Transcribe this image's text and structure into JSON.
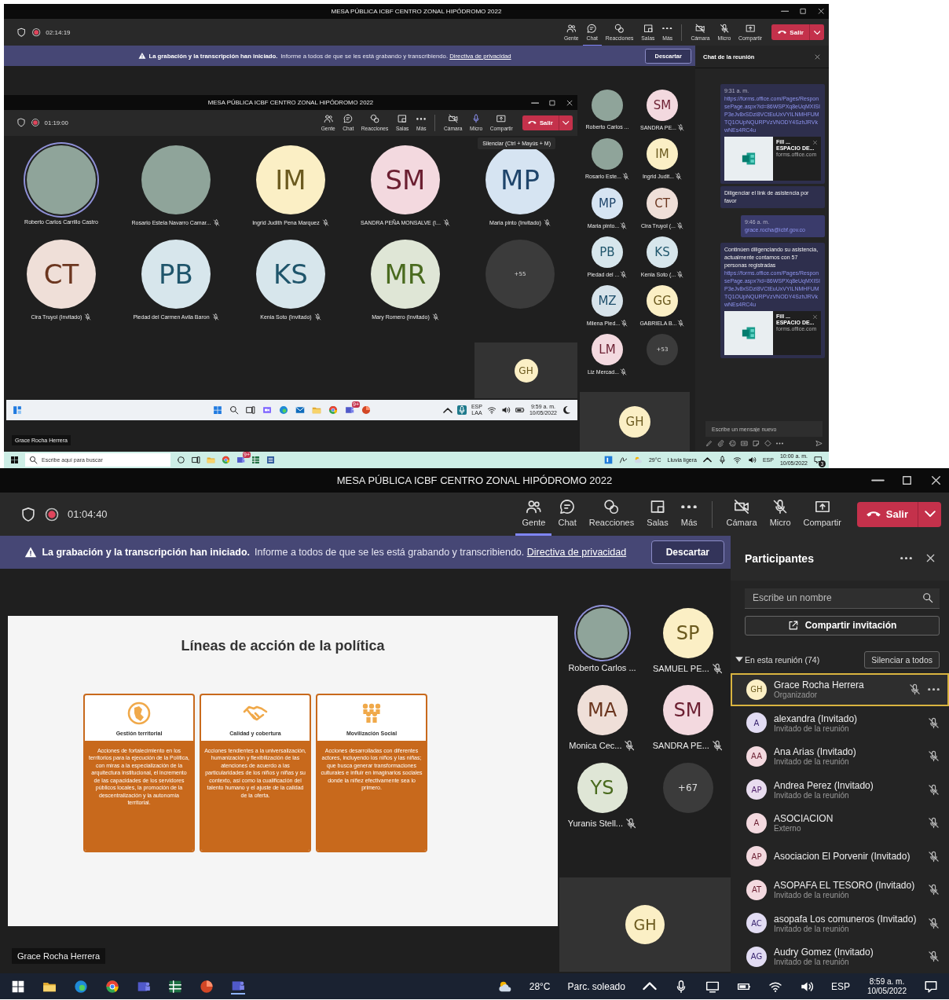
{
  "top": {
    "window": {
      "title": "MESA PÚBLICA ICBF CENTRO ZONAL HIPÓDROMO 2022"
    },
    "timer": "02:14:19",
    "tools": [
      {
        "kind": "people",
        "label": "Gente",
        "selected": false
      },
      {
        "kind": "chat",
        "label": "Chat",
        "selected": true
      },
      {
        "kind": "reactions",
        "label": "Reacciones",
        "selected": false
      },
      {
        "kind": "rooms",
        "label": "Salas",
        "selected": false
      },
      {
        "kind": "more",
        "label": "Más",
        "selected": false
      }
    ],
    "controls": [
      {
        "kind": "camera",
        "label": "Cámara",
        "on": false
      },
      {
        "kind": "mic",
        "label": "Micro",
        "on": false
      },
      {
        "kind": "share",
        "label": "Compartir"
      }
    ],
    "leave": "Salir",
    "banner": {
      "title": "La grabación y la transcripción han iniciado.",
      "text": "Informe a todos de que se les está grabando y transcribiendo.",
      "link": "Directiva de privacidad",
      "button": "Descartar"
    },
    "shared_screen": {
      "window": {
        "title": "MESA PÚBLICA ICBF CENTRO ZONAL HIPÓDROMO 2022"
      },
      "timer": "01:19:00",
      "tools": [
        {
          "kind": "people",
          "label": "Gente",
          "selected": false
        },
        {
          "kind": "chat",
          "label": "Chat",
          "selected": false
        },
        {
          "kind": "reactions",
          "label": "Reacciones",
          "selected": false
        },
        {
          "kind": "rooms",
          "label": "Salas",
          "selected": false
        },
        {
          "kind": "more",
          "label": "Más",
          "selected": false
        }
      ],
      "controls": [
        {
          "kind": "camera",
          "label": "Cámara",
          "on": false
        },
        {
          "kind": "mic",
          "label": "Micro",
          "on": true
        },
        {
          "kind": "share",
          "label": "Compartir"
        }
      ],
      "leave": "Salir",
      "tooltip": "Silenciar (Ctrl + Mayús + M)",
      "tiles": [
        {
          "kind": "photo",
          "name": "Roberto Carlos Carrillo Castro",
          "speaking": true,
          "muted": false
        },
        {
          "kind": "photo",
          "name": "Rosario Estela Navarro Camar...",
          "speaking": false,
          "muted": true
        },
        {
          "kind": "initials",
          "initials": "IM",
          "color": "#fbefc5",
          "name": "Ingrid Judith Pena Marquez",
          "speaking": false,
          "muted": true
        },
        {
          "kind": "initials",
          "initials": "SM",
          "color": "#f3d9df",
          "name": "SANDRA PEÑA MONSALVE (I...",
          "speaking": false,
          "muted": true
        },
        {
          "kind": "initials",
          "initials": "MP",
          "color": "#d6e4f2",
          "name": "Maria pinto (Invitado)",
          "speaking": false,
          "muted": true
        },
        {
          "kind": "initials",
          "initials": "CT",
          "color": "#efdfd8",
          "name": "Cira Truyol (Invitado)",
          "speaking": false,
          "muted": true
        },
        {
          "kind": "initials",
          "initials": "PB",
          "color": "#d7e6ec",
          "name": "Piedad del Carmen Avila Baron",
          "speaking": false,
          "muted": true
        },
        {
          "kind": "initials",
          "initials": "KS",
          "color": "#d7e6ec",
          "name": "Kenia Soto (Invitado)",
          "speaking": false,
          "muted": true
        },
        {
          "kind": "initials",
          "initials": "MR",
          "color": "#dfe6d6",
          "name": "Mary Romero (Invitado)",
          "speaking": false,
          "muted": true
        },
        {
          "kind": "overflow",
          "label": "+55"
        }
      ],
      "self": {
        "initials": "GH",
        "color": "#fbefc5"
      },
      "taskbar": {
        "badge": "9+",
        "language": "ESP",
        "layout": "LAA",
        "time": "9:59 a. m.",
        "date": "10/05/2022"
      }
    },
    "gallery": [
      {
        "kind": "photo",
        "name": "Roberto Carlos ...",
        "speaking": false,
        "muted": false
      },
      {
        "kind": "initials",
        "initials": "SM",
        "color": "#f3d9df",
        "name": "SANDRA PE...",
        "speaking": false,
        "muted": true
      },
      {
        "kind": "photo",
        "name": "Rosario Este...",
        "speaking": false,
        "muted": true
      },
      {
        "kind": "initials",
        "initials": "IM",
        "color": "#fbefc5",
        "name": "Ingrid Judit...",
        "speaking": false,
        "muted": true
      },
      {
        "kind": "initials",
        "initials": "MP",
        "color": "#d6e4f2",
        "name": "Maria pinto...",
        "speaking": false,
        "muted": true
      },
      {
        "kind": "initials",
        "initials": "CT",
        "color": "#efdfd8",
        "name": "Cira Truyol (...",
        "speaking": false,
        "muted": true
      },
      {
        "kind": "initials",
        "initials": "PB",
        "color": "#d7e6ec",
        "name": "Piedad del ...",
        "speaking": false,
        "muted": true
      },
      {
        "kind": "initials",
        "initials": "KS",
        "color": "#d7e6ec",
        "name": "Kenia Soto (...",
        "speaking": false,
        "muted": true
      },
      {
        "kind": "initials",
        "initials": "MZ",
        "color": "#d7e3ea",
        "name": "Milena Pied...",
        "speaking": false,
        "muted": true
      },
      {
        "kind": "initials",
        "initials": "GG",
        "color": "#fbefc5",
        "name": "GABRIELA B...",
        "speaking": false,
        "muted": true
      },
      {
        "kind": "initials",
        "initials": "LM",
        "color": "#f3d9df",
        "name": "Liz Mercad...",
        "speaking": false,
        "muted": true
      },
      {
        "kind": "overflow",
        "label": "+53"
      }
    ],
    "self": {
      "initials": "GH",
      "color": "#fbefc5"
    },
    "name_tag": "Grace Rocha Herrera",
    "chat": {
      "title": "Chat de la reunión",
      "messages": [
        {
          "self": false,
          "time": "9:31 a. m.",
          "link": "https://forms.office.com/Pages/ResponsePage.aspx?id=86WSPXq8eUqMXISIP3eJv8xSDzi8VCtEuUxVYILNMHFUMTQ1OUpNQURPVzVNODY4SzhJRVkwNEs4RC4u",
          "card": {
            "title": "Fill ...",
            "subtitle": "ESPACIO DE...",
            "domain": "forms.office.com"
          }
        },
        {
          "self": false,
          "text": "Diligenciar el link de asistencia por favor"
        },
        {
          "self": true,
          "time": "9:46 a. m.",
          "link": "grace.rocha@icbf.gov.co"
        },
        {
          "self": false,
          "text": "Continúen diligenciando su asistencia, actualmente contamos con 57 personas registradas",
          "link": "https://forms.office.com/Pages/ResponsePage.aspx?id=86WSPXq8eUqMXISIP3eJv8xSDzi8VCtEuUxVYILNMHFUMTQ1OUpNQURPVzVNODY4SzhJRVkwNEs4RC4u",
          "card": {
            "title": "Fill ...",
            "subtitle": "ESPACIO DE...",
            "domain": "forms.office.com"
          }
        }
      ],
      "compose": {
        "placeholder": "Escribe un mensaje nuevo"
      }
    },
    "taskbar": {
      "search": {
        "placeholder": "Escribe aquí para buscar"
      },
      "badge": "9+",
      "temperature": "29°C",
      "weather": "Lluvia ligera",
      "language": "ESP",
      "time": "10:00 a. m.",
      "date": "10/05/2022",
      "notifications": "3"
    }
  },
  "bottom": {
    "window": {
      "title": "MESA PÚBLICA ICBF CENTRO ZONAL HIPÓDROMO 2022"
    },
    "timer": "01:04:40",
    "tools": [
      {
        "kind": "people",
        "label": "Gente",
        "selected": true
      },
      {
        "kind": "chat",
        "label": "Chat",
        "selected": false
      },
      {
        "kind": "reactions",
        "label": "Reacciones",
        "selected": false
      },
      {
        "kind": "rooms",
        "label": "Salas",
        "selected": false
      },
      {
        "kind": "more",
        "label": "Más",
        "selected": false
      }
    ],
    "controls": [
      {
        "kind": "camera",
        "label": "Cámara",
        "on": false
      },
      {
        "kind": "mic",
        "label": "Micro",
        "on": false
      },
      {
        "kind": "share",
        "label": "Compartir"
      }
    ],
    "leave": "Salir",
    "banner": {
      "title": "La grabación y la transcripción han iniciado.",
      "text": "Informe a todos de que se les está grabando y transcribiendo.",
      "link": "Directiva de privacidad",
      "button": "Descartar"
    },
    "slide": {
      "title": "Líneas de acción de la política",
      "cards": [
        {
          "kind": "globe",
          "title": "Gestión territorial",
          "text": "Acciones de fortalecimiento en los territorios para la ejecución de la Política, con miras a la especialización de la arquitectura institucional, el incremento de las capacidades de los servidores públicos locales, la promoción de la descentralización y la autonomía territorial."
        },
        {
          "kind": "handshake",
          "title": "Calidad y cobertura",
          "text": "Acciones tendientes a la universalización, humanización y flexibilización de las atenciones de acuerdo a las particularidades de los niños y niñas y su contexto, así como la cualificación del talento humano y el ajuste de la calidad de la oferta."
        },
        {
          "kind": "group",
          "title": "Movilización Social",
          "text": "Acciones desarrolladas con diferentes actores, incluyendo los niños y las niñas; que busca generar transformaciones culturales e influir en imaginarios sociales donde la niñez efectivamente sea lo primero."
        }
      ]
    },
    "gallery": [
      {
        "kind": "photo",
        "name": "Roberto Carlos ...",
        "speaking": true,
        "muted": false
      },
      {
        "kind": "initials",
        "initials": "SP",
        "color": "#fbefc5",
        "name": "SAMUEL PE...",
        "speaking": false,
        "muted": true
      },
      {
        "kind": "initials",
        "initials": "MA",
        "color": "#efdfd8",
        "name": "Monica Cec...",
        "speaking": false,
        "muted": true
      },
      {
        "kind": "initials",
        "initials": "SM",
        "color": "#f3d9df",
        "name": "SANDRA PE...",
        "speaking": false,
        "muted": true
      },
      {
        "kind": "initials",
        "initials": "YS",
        "color": "#dfe6d6",
        "name": "Yuranis Stell...",
        "speaking": false,
        "muted": true
      },
      {
        "kind": "overflow",
        "label": "+67"
      }
    ],
    "self": {
      "initials": "GH",
      "color": "#fbefc5"
    },
    "name_tag": "Grace Rocha Herrera",
    "participants": {
      "title": "Participantes",
      "search": {
        "placeholder": "Escribe un nombre"
      },
      "invite": "Compartir invitación",
      "section": {
        "label": "En esta reunión (74)",
        "expanded": true
      },
      "mute_all": "Silenciar a todos",
      "people": [
        {
          "initials": "GH",
          "color": "#fbefc5",
          "name": "Grace Rocha Herrera",
          "role": "Organizador",
          "selected": true,
          "muted": true
        },
        {
          "initials": "A",
          "color": "#e2dcf3",
          "name": "alexandra (Invitado)",
          "role": "Invitado de la reunión",
          "selected": false,
          "muted": true
        },
        {
          "initials": "AA",
          "color": "#f3d9df",
          "name": "Ana Arias (Invitado)",
          "role": "Invitado de la reunión",
          "selected": false,
          "muted": true
        },
        {
          "initials": "AP",
          "color": "#e8dcef",
          "name": "Andrea Perez (Invitado)",
          "role": "Invitado de la reunión",
          "selected": false,
          "muted": true
        },
        {
          "initials": "A",
          "color": "#f3d9df",
          "name": "ASOCIACION",
          "role": "Externo",
          "selected": false,
          "muted": true
        },
        {
          "initials": "AP",
          "color": "#f3d9df",
          "name": "Asociacion El Porvenir (Invitado)",
          "selected": false,
          "muted": true
        },
        {
          "initials": "AT",
          "color": "#f3d9df",
          "name": "ASOPAFA EL TESORO (Invitado)",
          "role": "Invitado de la reunión",
          "selected": false,
          "muted": true
        },
        {
          "initials": "AC",
          "color": "#e2dcf3",
          "name": "asopafa Los comuneros (Invitado)",
          "role": "Invitado de la reunión",
          "selected": false,
          "muted": true
        },
        {
          "initials": "AG",
          "color": "#e2dcf3",
          "name": "Audry Gomez (Invitado)",
          "role": "Invitado de la reunión",
          "selected": false,
          "muted": true
        }
      ]
    },
    "taskbar": {
      "temperature": "28°C",
      "weather": "Parc. soleado",
      "language": "ESP",
      "time": "8:59 a. m.",
      "date": "10/05/2022"
    }
  }
}
